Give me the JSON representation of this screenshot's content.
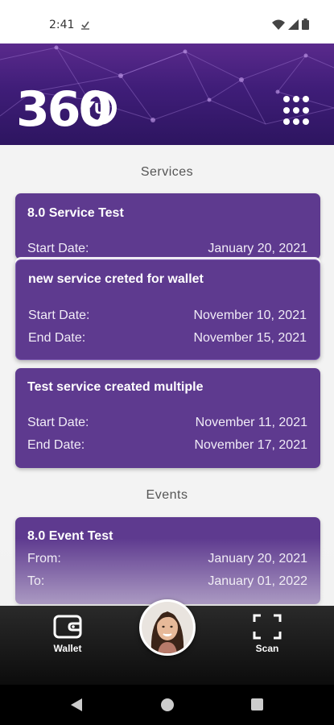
{
  "status_bar": {
    "time": "2:41",
    "icons": [
      "download-done-icon",
      "wifi-icon",
      "signal-icon",
      "battery-icon"
    ]
  },
  "header": {
    "logo_text": "360",
    "logo_badge_letter": "U",
    "menu_icon": "grid-menu-icon",
    "gradient_colors": [
      "#5a2a8c",
      "#2d1560"
    ]
  },
  "services": {
    "title": "Services",
    "items": [
      {
        "name": "8.0 Service Test",
        "start_label": "Start Date:",
        "start_date": "January 20, 2021"
      },
      {
        "name": "new service creted for wallet",
        "start_label": "Start Date:",
        "start_date": "November 10, 2021",
        "end_label": "End Date:",
        "end_date": "November 15, 2021"
      },
      {
        "name": "Test service created multiple",
        "start_label": "Start Date:",
        "start_date": "November 11, 2021",
        "end_label": "End Date:",
        "end_date": "November 17, 2021"
      }
    ]
  },
  "events": {
    "title": "Events",
    "items": [
      {
        "name": "8.0 Event Test",
        "from_label": "From:",
        "from_date": "January 20, 2021",
        "to_label": "To:",
        "to_date": "January 01, 2022"
      }
    ]
  },
  "bottom_nav": {
    "wallet_label": "Wallet",
    "scan_label": "Scan",
    "wallet_icon": "wallet-icon",
    "scan_icon": "scan-icon",
    "profile_icon": "avatar"
  },
  "colors": {
    "card": "#5e3a8f",
    "nav_bg": "#0c0c0c"
  }
}
